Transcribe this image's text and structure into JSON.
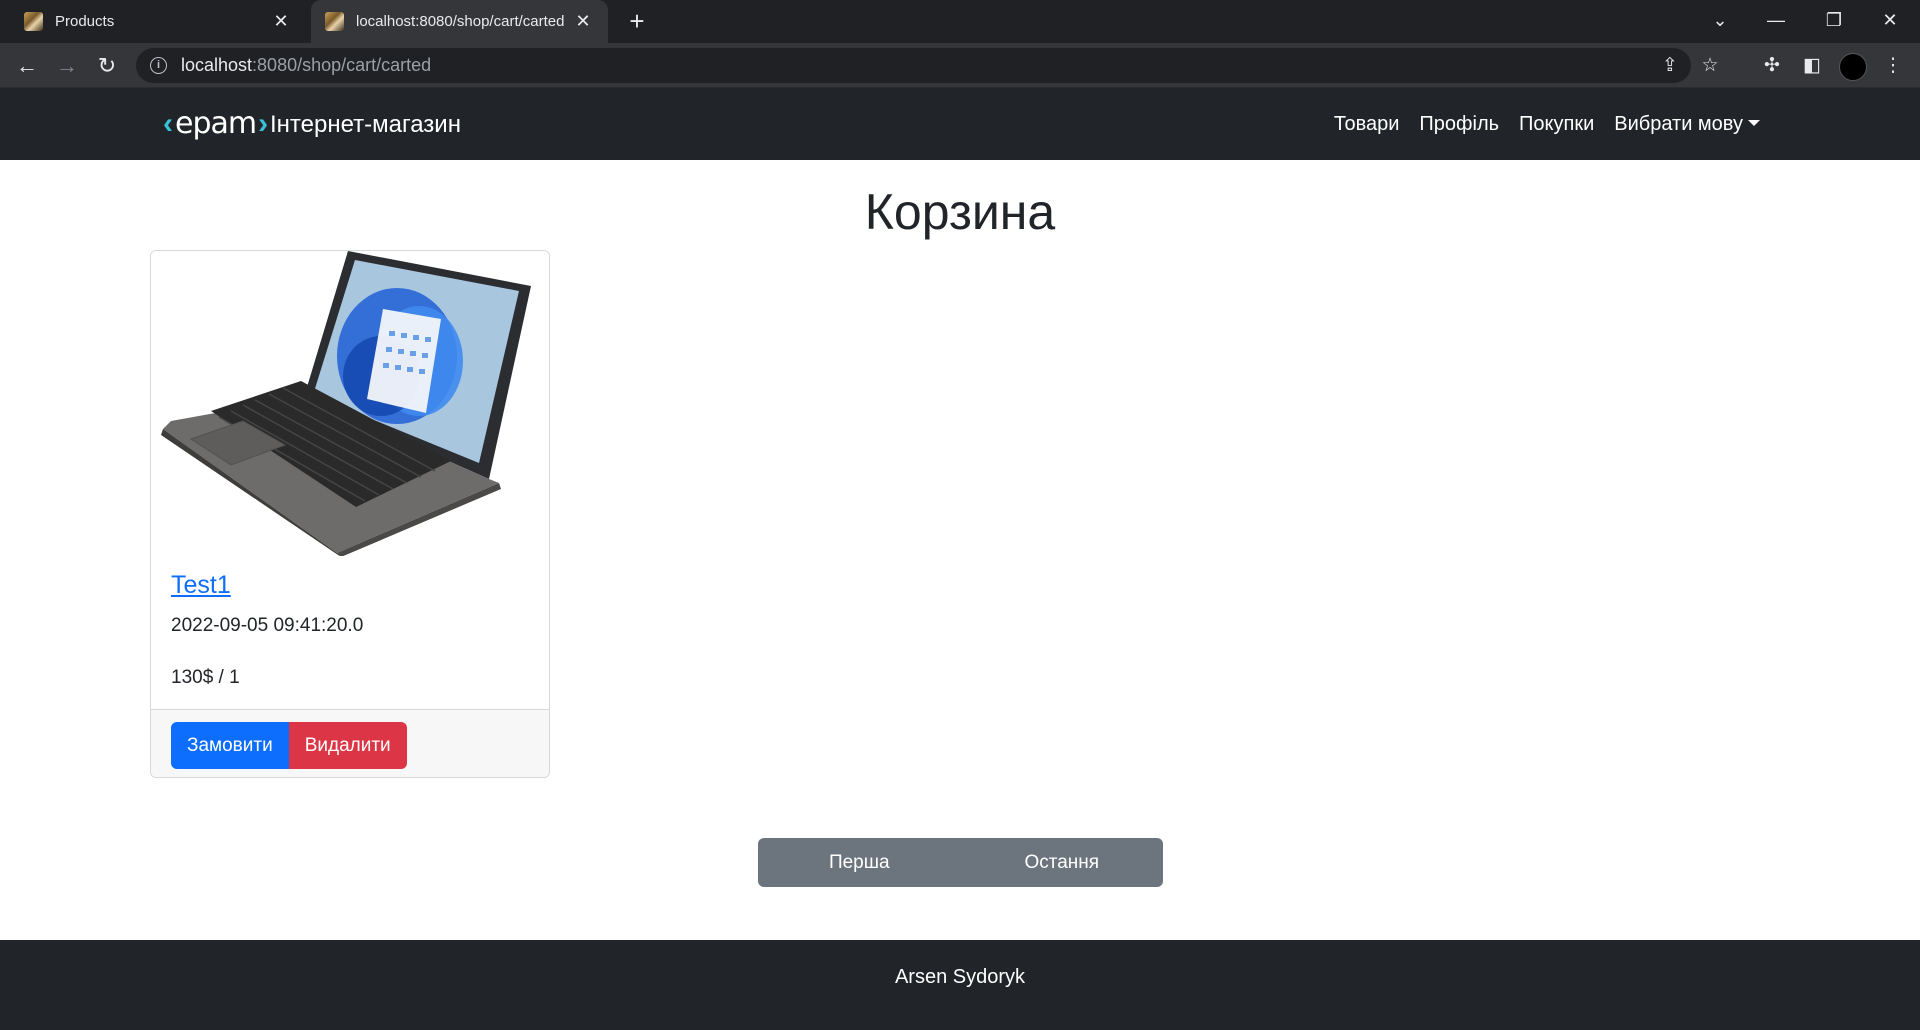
{
  "browser": {
    "tabs": [
      {
        "title": "Products",
        "active": false
      },
      {
        "title": "localhost:8080/shop/cart/carted",
        "active": true
      }
    ],
    "url_host": "localhost",
    "url_rest": ":8080/shop/cart/carted"
  },
  "navbar": {
    "logo_text": "epam",
    "brand": "Інтернет-магазин",
    "links": [
      "Товари",
      "Профіль",
      "Покупки",
      "Вибрати мову"
    ]
  },
  "page": {
    "title": "Корзина"
  },
  "cart_item": {
    "name": "Test1",
    "date": "2022-09-05 09:41:20.0",
    "price_qty": "130$ / 1",
    "order_label": "Замовити",
    "delete_label": "Видалити"
  },
  "pagination": {
    "first_label": "Перша",
    "last_label": "Остання"
  },
  "footer": {
    "author": "Arsen Sydoryk"
  },
  "colors": {
    "navbar_bg": "#212529",
    "primary": "#0d6efd",
    "danger": "#dc3545",
    "secondary": "#6c757d",
    "logo_accent": "#39c2d7"
  }
}
